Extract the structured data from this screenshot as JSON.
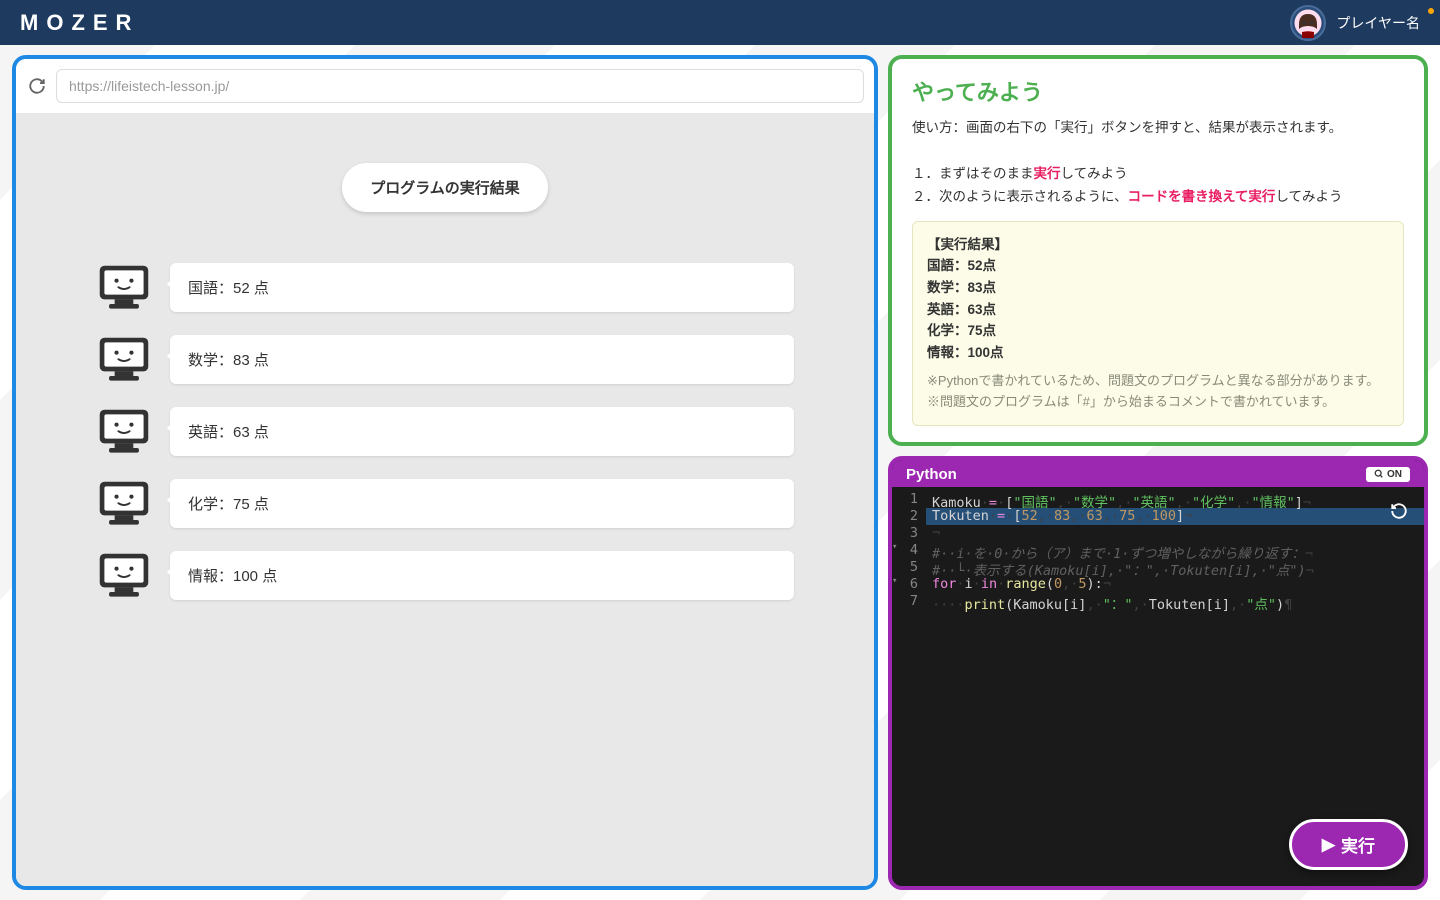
{
  "topbar": {
    "logo": "MOZER",
    "player_name": "プレイヤー名"
  },
  "preview": {
    "url": "https://lifeistech-lesson.jp/",
    "result_title": "プログラムの実行結果",
    "results": [
      "国語：52 点",
      "数学：83 点",
      "英語：63 点",
      "化学：75 点",
      "情報：100 点"
    ]
  },
  "instructions": {
    "title": "やってみよう",
    "usage": "使い方：画面の右下の「実行」ボタンを押すと、結果が表示されます。",
    "step1_prefix": "１．まずはそのまま",
    "step1_accent": "実行",
    "step1_suffix": "してみよう",
    "step2_prefix": "２．次のように表示されるように、",
    "step2_accent": "コードを書き換えて実行",
    "step2_suffix": "してみよう",
    "example_header": "【実行結果】",
    "example_lines": [
      "国語：52点",
      "数学：83点",
      "英語：63点",
      "化学：75点",
      "情報：100点"
    ],
    "note1": "※Pythonで書かれているため、問題文のプログラムと異なる部分があります。",
    "note2": "※問題文のプログラムは「#」から始まるコメントで書かれています。"
  },
  "editor": {
    "language": "Python",
    "zoom_label": "ON",
    "run_label": "実行",
    "code": {
      "l1_var": "Kamoku",
      "l1_subjects": [
        "国語",
        "数学",
        "英語",
        "化学",
        "情報"
      ],
      "l2_var": "Tokuten",
      "l2_values": [
        52,
        83,
        63,
        75,
        100
      ],
      "l4_comment": "#··i·を·0·から（ア）まで·1·ずつ増やしながら繰り返す：",
      "l5_comment": "#··└·表示する(Kamoku[i],·\"：\",·Tokuten[i],·\"点\")",
      "l6_for": "for",
      "l6_in": "in",
      "l6_range": "range",
      "l6_args": "0, 5",
      "l7_fn": "print",
      "l7_args": "Kamoku[i], \"：\", Tokuten[i], \"点\""
    }
  }
}
